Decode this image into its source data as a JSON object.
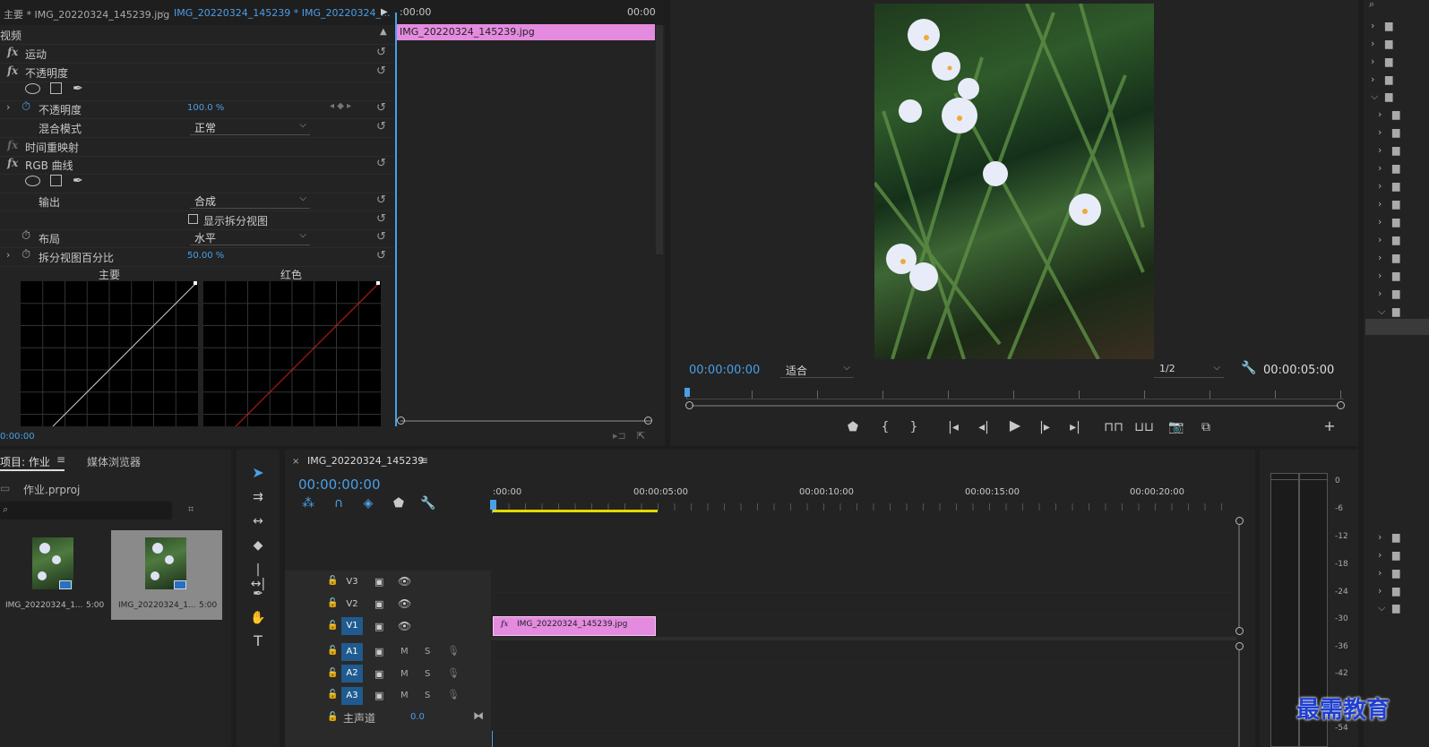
{
  "effect_controls": {
    "tab_main": "主要 * IMG_20220324_145239.jpg",
    "tab_clip": "IMG_20220324_145239 * IMG_20220324_...",
    "time_start": ":00:00",
    "time_end": "00:00",
    "clip_label": "IMG_20220324_145239.jpg",
    "section_video": "视频",
    "fx_motion": "运动",
    "fx_opacity": "不透明度",
    "opacity_label": "不透明度",
    "opacity_value": "100.0 %",
    "blend_label": "混合模式",
    "blend_value": "正常",
    "time_remap": "时间重映射",
    "rgb_curves": "RGB 曲线",
    "output_label": "输出",
    "output_value": "合成",
    "split_view_label": "显示拆分视图",
    "layout_label": "布局",
    "layout_value": "水平",
    "split_pct_label": "拆分视图百分比",
    "split_pct_value": "50.00 %",
    "curve_main_label": "主要",
    "curve_red_label": "红色",
    "timecode": "0:00:00"
  },
  "program_monitor": {
    "timecode": "00:00:00:00",
    "fit_value": "适合",
    "res_value": "1/2",
    "duration": "00:00:05:00"
  },
  "project": {
    "tab_project": "项目: 作业",
    "tab_media": "媒体浏览器",
    "project_file": "作业.prproj",
    "items": [
      {
        "name": "IMG_20220324_1...",
        "duration": "5:00"
      },
      {
        "name": "IMG_20220324_1...",
        "duration": "5:00"
      }
    ]
  },
  "timeline": {
    "sequence_name": "IMG_20220324_145239",
    "timecode": "00:00:00:00",
    "ruler": [
      ":00:00",
      "00:00:05:00",
      "00:00:10:00",
      "00:00:15:00",
      "00:00:20:00"
    ],
    "tracks_video": [
      "V3",
      "V2",
      "V1"
    ],
    "tracks_audio": [
      "A1",
      "A2",
      "A3"
    ],
    "mute": "M",
    "solo": "S",
    "master_label": "主声道",
    "master_value": "0.0",
    "clip_label": "IMG_20220324_145239.jpg"
  },
  "audio_meter": {
    "scale": [
      "0",
      "-6",
      "-12",
      "-18",
      "-24",
      "-30",
      "-36",
      "-42",
      "-54"
    ]
  },
  "watermark": "最需教育",
  "colors": {
    "accent": "#4a9fe8",
    "clip_pink": "#e48be0",
    "panel_bg": "#232323",
    "work_area": "#e6d800"
  }
}
